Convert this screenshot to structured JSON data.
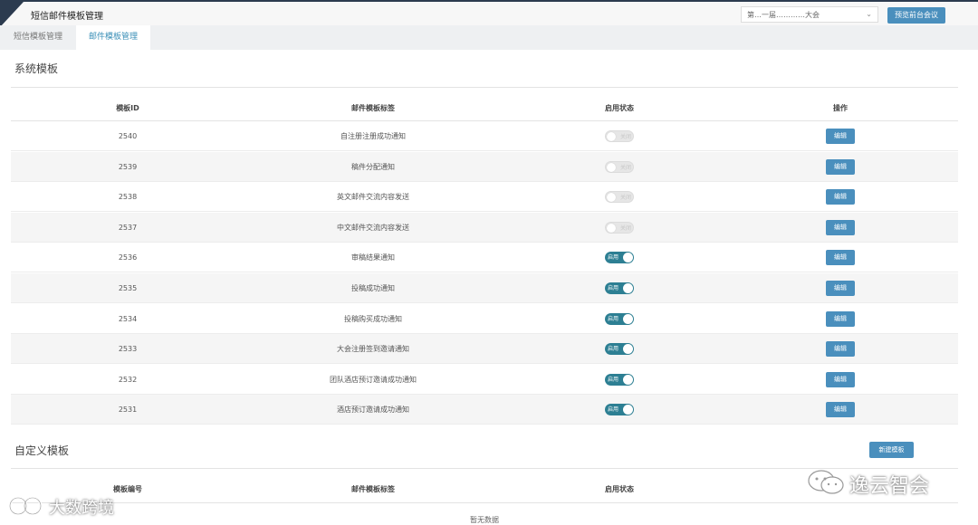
{
  "app": {
    "title": "短信邮件模板管理"
  },
  "header": {
    "conference_select_value": "第…一届…………大会",
    "preview_button": "预览前台会议"
  },
  "tabs": [
    {
      "label": "短信模板管理",
      "active": false
    },
    {
      "label": "邮件模板管理",
      "active": true
    }
  ],
  "system_section": {
    "title": "系统模板",
    "columns": [
      "模板ID",
      "邮件模板标签",
      "启用状态",
      "操作"
    ],
    "rows": [
      {
        "id": "2540",
        "name": "自注册注册成功通知",
        "enabled": false,
        "state_label": "关闭",
        "action": "编辑"
      },
      {
        "id": "2539",
        "name": "稿件分配通知",
        "enabled": false,
        "state_label": "关闭",
        "action": "编辑"
      },
      {
        "id": "2538",
        "name": "英文邮件交流内容发送",
        "enabled": false,
        "state_label": "关闭",
        "action": "编辑"
      },
      {
        "id": "2537",
        "name": "中文邮件交流内容发送",
        "enabled": false,
        "state_label": "关闭",
        "action": "编辑"
      },
      {
        "id": "2536",
        "name": "审稿结果通知",
        "enabled": true,
        "state_label": "启用",
        "action": "编辑"
      },
      {
        "id": "2535",
        "name": "投稿成功通知",
        "enabled": true,
        "state_label": "启用",
        "action": "编辑"
      },
      {
        "id": "2534",
        "name": "投稿购买成功通知",
        "enabled": true,
        "state_label": "启用",
        "action": "编辑"
      },
      {
        "id": "2533",
        "name": "大会注册签到邀请通知",
        "enabled": true,
        "state_label": "启用",
        "action": "编辑"
      },
      {
        "id": "2532",
        "name": "团队酒店预订邀请成功通知",
        "enabled": true,
        "state_label": "启用",
        "action": "编辑"
      },
      {
        "id": "2531",
        "name": "酒店预订邀请成功通知",
        "enabled": true,
        "state_label": "启用",
        "action": "编辑"
      }
    ]
  },
  "custom_section": {
    "title": "自定义模板",
    "new_button": "新建模板",
    "columns": [
      "模板编号",
      "邮件模板标签",
      "启用状态"
    ],
    "empty_text": "暂无数据"
  },
  "watermarks": {
    "left": "大数跨境",
    "right": "逸云智会"
  },
  "colors": {
    "primary_button": "#4a8fbd",
    "toggle_on": "#2d7f93",
    "header_bar": "#2c3b4f"
  }
}
